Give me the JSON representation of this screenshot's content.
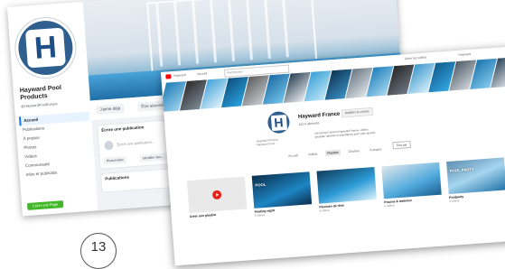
{
  "facebook": {
    "page_name": "Hayward Pool Products",
    "handle": "@HaywardPoolEurope",
    "nav": [
      "Accueil",
      "Publications",
      "À propos",
      "Photos",
      "Vidéos",
      "Communauté",
      "Infos et publicités"
    ],
    "create_page_label": "Créer une Page",
    "action_buttons": [
      "J'aime déjà",
      "Être abonné(e)"
    ],
    "feed": {
      "create_post_title": "Écrire une publication",
      "placeholder": "Écrire une publication...",
      "chips": [
        "Photo/vidéo",
        "Identifier des..."
      ],
      "publications_title": "Publications"
    }
  },
  "youtube": {
    "top_links": [
      "Hayward",
      "Accueil"
    ],
    "search_placeholder": "Rechercher",
    "right_links": [
      "Gérer les vidéos",
      "Hayward"
    ],
    "channel_name": "Hayward France",
    "subscribers": "162 k abonnés",
    "customize_label": "Modifier la chaîne",
    "side_links": [
      "Hayward Piscine",
      "Hayward Pool"
    ],
    "description": "Découvrez l'univers Hayward France, vidéos produits, tutoriels et inspirations pour votre piscine.",
    "tabs": [
      "Accueil",
      "Vidéos",
      "Playlists",
      "Chaînes",
      "À propos"
    ],
    "active_tab_index": 2,
    "sort_label": "Trier par",
    "videos": [
      {
        "title": "Créer une playlist",
        "meta": "",
        "type": "create"
      },
      {
        "title": "Pooling night",
        "meta": "5 vidéos",
        "thumb_label": "POOL"
      },
      {
        "title": "Piscines de rêve",
        "meta": "8 vidéos",
        "thumb_label": ""
      },
      {
        "title": "Piscine & Intérieur",
        "meta": "6 vidéos",
        "thumb_label": ""
      },
      {
        "title": "Poolparty",
        "meta": "4 vidéos",
        "thumb_label": "POOL PARTY"
      }
    ]
  },
  "page_number": "13",
  "colors": {
    "facebook_blue": "#1877f2",
    "hayward_blue": "#2e5f8e",
    "youtube_red": "#ff0000"
  }
}
